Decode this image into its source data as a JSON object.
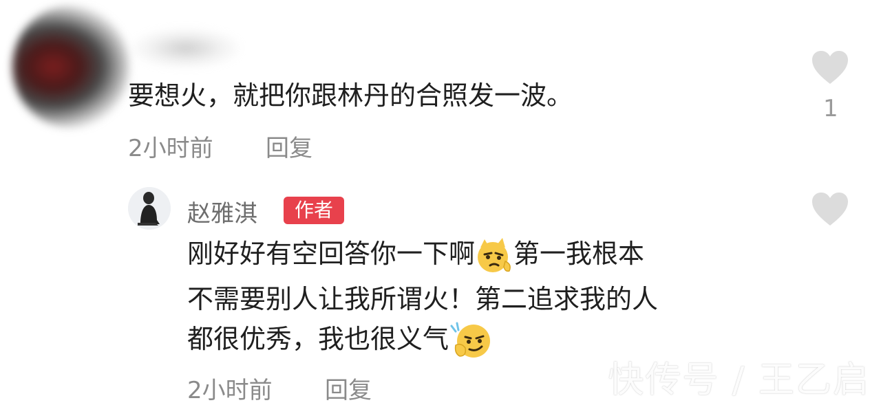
{
  "comment": {
    "text": "要想火，就把你跟林丹的合照发一波。",
    "time": "2小时前",
    "reply_label": "回复",
    "like_count": "1"
  },
  "reply": {
    "author_name": "赵雅淇",
    "author_badge": "作者",
    "line1_a": "刚好好有空回答你一下啊",
    "line1_b": "第一我根本",
    "line2": "不需要别人让我所谓火！第二追求我的人",
    "line3": "都很优秀，我也很义气",
    "time": "2小时前",
    "reply_label": "回复",
    "emoji1": "smirk-cat-emoji",
    "emoji2": "thinking-smirk-emoji"
  },
  "watermark": "快传号 / 王乙启",
  "colors": {
    "badge": "#e8414c",
    "meta": "#8a8a8a",
    "heart": "#dcdcdc"
  }
}
